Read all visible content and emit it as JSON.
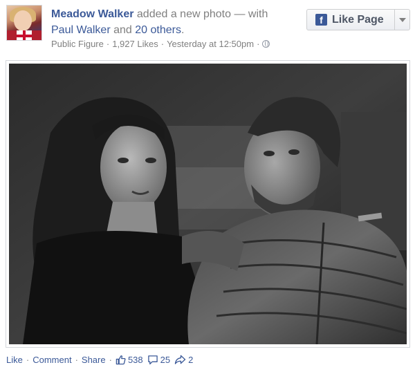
{
  "post": {
    "author": "Meadow Walker",
    "action_text": "added a new photo — with",
    "tagged_person": "Paul Walker",
    "and_text": "and",
    "others_text": "20 others",
    "period": ".",
    "meta": {
      "category": "Public Figure",
      "likes": "1,927 Likes",
      "timestamp": "Yesterday at 12:50pm",
      "privacy_icon": "globe-icon"
    },
    "like_page_button": {
      "label": "Like Page",
      "icon": "facebook-f-icon"
    }
  },
  "footer": {
    "like": "Like",
    "comment": "Comment",
    "share": "Share",
    "like_count": "538",
    "comment_count": "25",
    "share_count": "2"
  },
  "colors": {
    "link_blue": "#3b5998",
    "muted_text": "#7f7f7f"
  }
}
